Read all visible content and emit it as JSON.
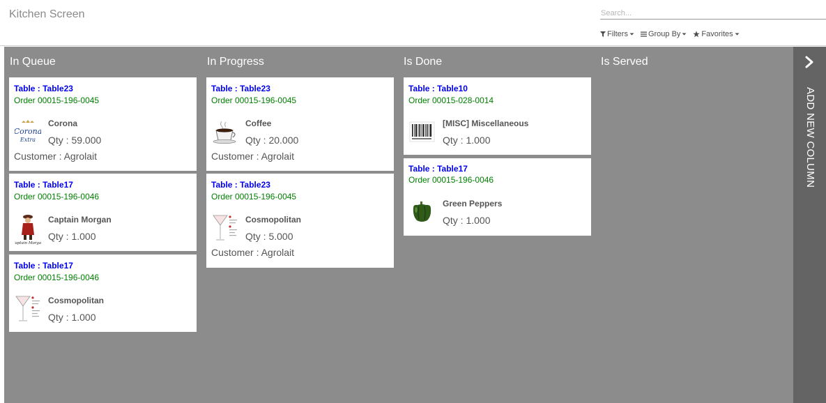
{
  "header": {
    "title": "Kitchen Screen",
    "search_placeholder": "Search...",
    "filters_label": "Filters",
    "group_by_label": "Group By",
    "favorites_label": "Favorites"
  },
  "columns": [
    {
      "title": "In Queue",
      "cards": [
        {
          "table": "Table : Table23",
          "order": "Order 00015-196-0045",
          "product": "Corona",
          "qty": "Qty : 59.000",
          "customer": "Customer : Agrolait",
          "icon": "corona-logo-icon"
        },
        {
          "table": "Table : Table17",
          "order": "Order 00015-196-0046",
          "product": "Captain Morgan",
          "qty": "Qty : 1.000",
          "icon": "captain-morgan-logo-icon"
        },
        {
          "table": "Table : Table17",
          "order": "Order 00015-196-0046",
          "product": "Cosmopolitan",
          "qty": "Qty : 1.000",
          "icon": "cocktail-glass-icon"
        }
      ]
    },
    {
      "title": "In Progress",
      "cards": [
        {
          "table": "Table : Table23",
          "order": "Order 00015-196-0045",
          "product": "Coffee",
          "qty": "Qty : 20.000",
          "customer": "Customer : Agrolait",
          "icon": "coffee-cup-icon"
        },
        {
          "table": "Table : Table23",
          "order": "Order 00015-196-0045",
          "product": "Cosmopolitan",
          "qty": "Qty : 5.000",
          "customer": "Customer : Agrolait",
          "icon": "cocktail-glass-icon"
        }
      ]
    },
    {
      "title": "Is Done",
      "cards": [
        {
          "table": "Table : Table10",
          "order": "Order 00015-028-0014",
          "product": "[MISC] Miscellaneous",
          "qty": "Qty : 1.000",
          "icon": "barcode-icon"
        },
        {
          "table": "Table : Table17",
          "order": "Order 00015-196-0046",
          "product": "Green Peppers",
          "qty": "Qty : 1.000",
          "icon": "green-pepper-icon"
        }
      ]
    },
    {
      "title": "Is Served",
      "cards": []
    }
  ],
  "add_column": {
    "label": "ADD NEW COLUMN"
  },
  "colors": {
    "table_text": "#0000ee",
    "order_text": "#008000",
    "kanban_background": "#8c8c8c",
    "add_column_background": "#646464"
  }
}
